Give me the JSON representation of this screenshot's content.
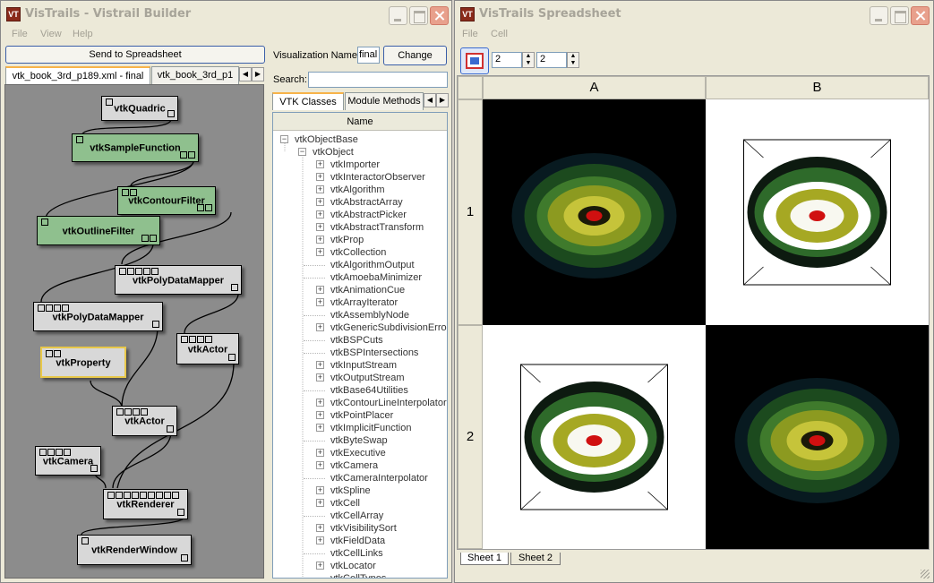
{
  "builder": {
    "title": "VisTrails - Vistrail Builder",
    "app_icon": "VT",
    "menu": [
      "File",
      "View",
      "Help"
    ],
    "send_button": "Send to Spreadsheet",
    "viz_name_label": "Visualization Name:",
    "viz_name_value": "final",
    "change_button": "Change",
    "search_label": "Search:",
    "search_value": "",
    "pipeline_tabs": [
      "vtk_book_3rd_p189.xml - final",
      "vtk_book_3rd_p1"
    ],
    "modules": [
      {
        "label": "vtkQuadric",
        "style": "gray",
        "ports": 1
      },
      {
        "label": "vtkSampleFunction",
        "style": "green",
        "ports": 1
      },
      {
        "label": "vtkContourFilter",
        "style": "green",
        "ports": 2
      },
      {
        "label": "vtkOutlineFilter",
        "style": "green",
        "ports": 1
      },
      {
        "label": "vtkPolyDataMapper",
        "style": "gray",
        "ports": 5
      },
      {
        "label": "vtkPolyDataMapper",
        "style": "gray",
        "ports": 4
      },
      {
        "label": "vtkProperty",
        "style": "yellow",
        "ports": 2
      },
      {
        "label": "vtkActor",
        "style": "gray",
        "ports": 4
      },
      {
        "label": "vtkActor",
        "style": "gray",
        "ports": 4
      },
      {
        "label": "vtkCamera",
        "style": "gray",
        "ports": 4
      },
      {
        "label": "vtkRenderer",
        "style": "gray",
        "ports": 9
      },
      {
        "label": "vtkRenderWindow",
        "style": "gray",
        "ports": 1
      }
    ],
    "side_tabs": [
      "VTK Classes",
      "Module Methods"
    ],
    "tree_header": "Name",
    "tree_root": "vtkObjectBase",
    "tree_level1": "vtkObject",
    "tree_children": [
      {
        "label": "vtkImporter",
        "expandable": true
      },
      {
        "label": "vtkInteractorObserver",
        "expandable": true
      },
      {
        "label": "vtkAlgorithm",
        "expandable": true
      },
      {
        "label": "vtkAbstractArray",
        "expandable": true
      },
      {
        "label": "vtkAbstractPicker",
        "expandable": true
      },
      {
        "label": "vtkAbstractTransform",
        "expandable": true
      },
      {
        "label": "vtkProp",
        "expandable": true
      },
      {
        "label": "vtkCollection",
        "expandable": true
      },
      {
        "label": "vtkAlgorithmOutput",
        "expandable": false
      },
      {
        "label": "vtkAmoebaMinimizer",
        "expandable": false
      },
      {
        "label": "vtkAnimationCue",
        "expandable": true
      },
      {
        "label": "vtkArrayIterator",
        "expandable": true
      },
      {
        "label": "vtkAssemblyNode",
        "expandable": false
      },
      {
        "label": "vtkGenericSubdivisionErrorMetric",
        "expandable": true
      },
      {
        "label": "vtkBSPCuts",
        "expandable": false
      },
      {
        "label": "vtkBSPIntersections",
        "expandable": false
      },
      {
        "label": "vtkInputStream",
        "expandable": true
      },
      {
        "label": "vtkOutputStream",
        "expandable": true
      },
      {
        "label": "vtkBase64Utilities",
        "expandable": false
      },
      {
        "label": "vtkContourLineInterpolator",
        "expandable": true
      },
      {
        "label": "vtkPointPlacer",
        "expandable": true
      },
      {
        "label": "vtkImplicitFunction",
        "expandable": true
      },
      {
        "label": "vtkByteSwap",
        "expandable": false
      },
      {
        "label": "vtkExecutive",
        "expandable": true
      },
      {
        "label": "vtkCamera",
        "expandable": true
      },
      {
        "label": "vtkCameraInterpolator",
        "expandable": false
      },
      {
        "label": "vtkSpline",
        "expandable": true
      },
      {
        "label": "vtkCell",
        "expandable": true
      },
      {
        "label": "vtkCellArray",
        "expandable": false
      },
      {
        "label": "vtkVisibilitySort",
        "expandable": true
      },
      {
        "label": "vtkFieldData",
        "expandable": true
      },
      {
        "label": "vtkCellLinks",
        "expandable": false
      },
      {
        "label": "vtkLocator",
        "expandable": true
      },
      {
        "label": "vtkCellTypes",
        "expandable": false
      }
    ]
  },
  "spreadsheet": {
    "title": "VisTrails Spreadsheet",
    "app_icon": "VT",
    "menu": [
      "File",
      "Cell"
    ],
    "rows_value": "2",
    "cols_value": "2",
    "col_headers": [
      "A",
      "B"
    ],
    "row_headers": [
      "1",
      "2"
    ],
    "sheet_tabs": [
      "Sheet 1",
      "Sheet 2"
    ],
    "cells": [
      {
        "background": "#000000",
        "outline": false
      },
      {
        "background": "#ffffff",
        "outline": true
      },
      {
        "background": "#ffffff",
        "outline": true
      },
      {
        "background": "#000000",
        "outline": false
      }
    ]
  }
}
